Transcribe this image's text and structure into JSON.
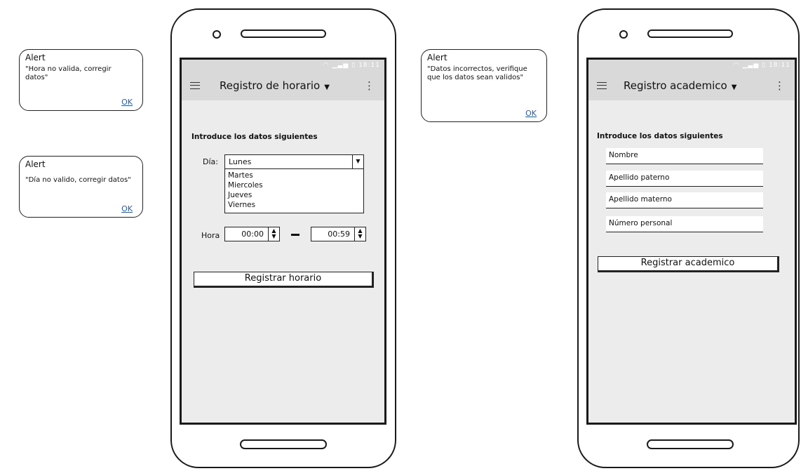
{
  "alerts": [
    {
      "title": "Alert",
      "message": "\"Hora no valida, corregir datos\"",
      "ok": "OK"
    },
    {
      "title": "Alert",
      "message": "\"Día no valido, corregir datos\"",
      "ok": "OK"
    },
    {
      "title": "Alert",
      "message": "\"Datos incorrectos, verifique que los datos sean validos\"",
      "ok": "OK"
    }
  ],
  "phone1": {
    "status": "18:11",
    "title": "Registro de horario",
    "intro": "Introduce los datos siguientes",
    "day_label": "Día:",
    "day_selected": "Lunes",
    "day_options": [
      "Martes",
      "Miercoles",
      "Jueves",
      "Viernes"
    ],
    "hour_label": "Hora",
    "hour_start": "00:00",
    "hour_end": "00:59",
    "submit": "Registrar horario"
  },
  "phone2": {
    "status": "18:11",
    "title": "Registro academico",
    "intro": "Introduce los datos siguientes",
    "fields": [
      "Nombre",
      "Apellido paterno",
      "Apellido materno",
      "Número personal"
    ],
    "submit": "Registrar academico"
  },
  "icons": [
    "menu-icon",
    "caret-down-icon",
    "more-vert-icon",
    "wifi-icon",
    "signal-icon",
    "battery-icon",
    "spinner-arrows-icon"
  ]
}
